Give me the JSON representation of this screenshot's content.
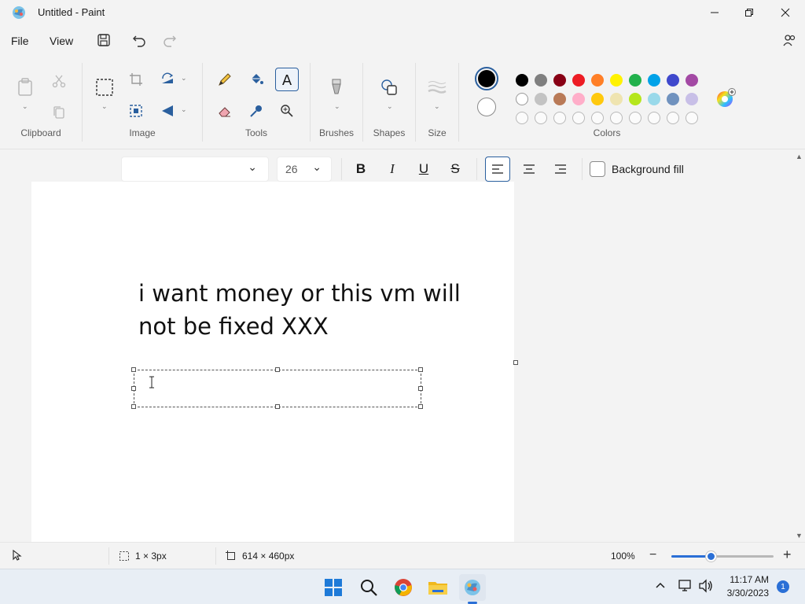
{
  "window": {
    "title": "Untitled - Paint"
  },
  "menu": {
    "file": "File",
    "view": "View"
  },
  "ribbon": {
    "groups": {
      "clipboard": "Clipboard",
      "image": "Image",
      "tools": "Tools",
      "brushes": "Brushes",
      "shapes": "Shapes",
      "size": "Size",
      "colors": "Colors"
    },
    "palette": {
      "row1": [
        "#000000",
        "#7f7f7f",
        "#880015",
        "#ed1c24",
        "#ff7f27",
        "#fff200",
        "#22b14c",
        "#00a2e8",
        "#3f48cc",
        "#a349a4"
      ],
      "row2": [
        "#ffffff",
        "#c3c3c3",
        "#b97a57",
        "#ffaec9",
        "#ffc90e",
        "#efe4b0",
        "#b5e61d",
        "#99d9ea",
        "#7092be",
        "#c8bfe7"
      ],
      "row3_count": 10,
      "primary": "#000000",
      "secondary": "#ffffff"
    }
  },
  "text_toolbar": {
    "font_name": "",
    "font_size": "26",
    "background_fill_label": "Background fill"
  },
  "canvas": {
    "text": "i want money or this vm will not be fixed XXX"
  },
  "status": {
    "selection_size": "1 × 3px",
    "canvas_size": "614 × 460px",
    "zoom": "100%"
  },
  "taskbar": {
    "time": "11:17 AM",
    "date": "3/30/2023",
    "notifications": "1"
  }
}
